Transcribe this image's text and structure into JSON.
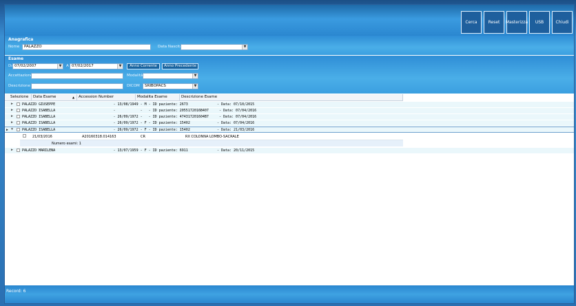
{
  "toolbar": {
    "buttons": [
      "Cerca",
      "Reset",
      "Masterizza",
      "USB",
      "Chiudi"
    ]
  },
  "anagrafica": {
    "title": "Anagrafica",
    "nome_label": "Nome",
    "nome_value": "PALAZZO",
    "data_nascita_label": "Data Nascita",
    "data_nascita_value": ""
  },
  "esame": {
    "title": "Esame",
    "da_label": "Da",
    "da_value": "07/02/2007",
    "a_label": "A",
    "a_value": "07/02/2017",
    "anno_corrente": "Anno Corrente",
    "anno_precedente": "Anno Precedente",
    "accettazione_label": "Accettazione",
    "accettazione_value": "",
    "modalita_label": "Modalità",
    "modalita_value": "",
    "descrizione_label": "Descrizione",
    "descrizione_value": "",
    "dicom_label": "DICOM",
    "dicom_value": "SRIBOPACS"
  },
  "grid": {
    "columns": [
      "Selezione",
      "Data Esame",
      "Accession Number",
      "Modalita Esame",
      "Descrizione Esame"
    ],
    "rows": [
      {
        "text": "PALAZZO GIUSEPPE                            - 13/08/1949 - M - ID paziente: 2673              - Data: 07/10/2015"
      },
      {
        "text": "PALAZZO ISABELLA                            -            -   - ID paziente: 2055172016B407     - Data: 07/04/2016"
      },
      {
        "text": "PALAZZO ISABELLA                            - 26/09/1972 -   - ID paziente: 474317201604B7     - Data: 07/04/2016"
      },
      {
        "text": "PALAZZO ISABELLA                            - 26/09/1972 - F - ID paziente: 15402             - Data: 07/04/2016"
      },
      {
        "text": "PALAZZO ISABELLA                            - 26/09/1972 - F - ID paziente: 15402             - Data: 21/03/2016"
      },
      {
        "text": "PALAZZO MARILENA                            - 13/07/1959 - F - ID paziente: 6911              - Data: 20/11/2015"
      }
    ],
    "detail": {
      "data": "21/03/2016",
      "accession": "A20160318.014163",
      "modalita": "CR",
      "descrizione": "RX COLONNA LOMBO-SACRALE",
      "count": "Numero esami: 1"
    }
  },
  "status": {
    "records": "Record: 6"
  }
}
